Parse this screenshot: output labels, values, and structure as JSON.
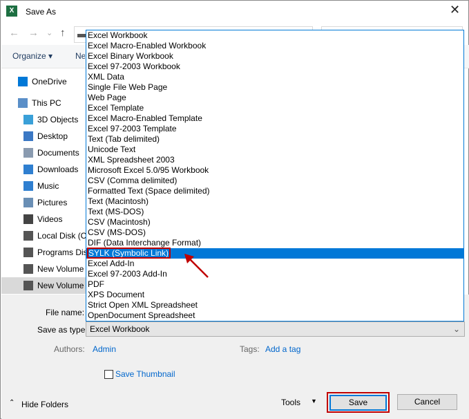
{
  "window": {
    "title": "Save As",
    "app_icon": "excel-icon",
    "close": "✕"
  },
  "nav": {
    "back": "←",
    "forward": "→",
    "recent": "⌄",
    "up": "↑"
  },
  "toolbar": {
    "organize": "Organize ▾",
    "new_folder": "New folder"
  },
  "sidebar": {
    "items": [
      {
        "label": "OneDrive",
        "icon": "cloud-icon",
        "color": "#0078d7",
        "top": true
      },
      {
        "label": "This PC",
        "icon": "computer-icon",
        "color": "#5a8fc8",
        "top": true
      },
      {
        "label": "3D Objects",
        "icon": "cube-icon",
        "color": "#3aa0d8"
      },
      {
        "label": "Desktop",
        "icon": "desktop-icon",
        "color": "#3b78c4"
      },
      {
        "label": "Documents",
        "icon": "document-icon",
        "color": "#8a9bb0"
      },
      {
        "label": "Downloads",
        "icon": "download-icon",
        "color": "#2f7fd0"
      },
      {
        "label": "Music",
        "icon": "music-icon",
        "color": "#2f7fd0"
      },
      {
        "label": "Pictures",
        "icon": "pictures-icon",
        "color": "#6a8fb5"
      },
      {
        "label": "Videos",
        "icon": "video-icon",
        "color": "#444"
      },
      {
        "label": "Local Disk (C:)",
        "icon": "drive-icon",
        "color": "#555"
      },
      {
        "label": "Programs Disk",
        "icon": "drive-icon",
        "color": "#555"
      },
      {
        "label": "New Volume",
        "icon": "drive-icon",
        "color": "#555"
      },
      {
        "label": "New Volume",
        "icon": "drive-icon",
        "color": "#555",
        "selected": true
      }
    ]
  },
  "form": {
    "file_name_label": "File name:",
    "save_as_type_label": "Save as type:",
    "save_as_type_value": "Excel Workbook",
    "authors_label": "Authors:",
    "authors_value": "Admin",
    "tags_label": "Tags:",
    "tags_value": "Add a tag",
    "thumbnail_label": "Save Thumbnail",
    "thumbnail_checked": false
  },
  "footer": {
    "hide_folders": "Hide Folders",
    "tools": "Tools",
    "save": "Save",
    "cancel": "Cancel"
  },
  "dropdown": {
    "selected_index": 21,
    "highlight_color": "#0078d7",
    "annotation_color": "#c00000",
    "options": [
      "Excel Workbook",
      "Excel Macro-Enabled Workbook",
      "Excel Binary Workbook",
      "Excel 97-2003 Workbook",
      "XML Data",
      "Single File Web Page",
      "Web Page",
      "Excel Template",
      "Excel Macro-Enabled Template",
      "Excel 97-2003 Template",
      "Text (Tab delimited)",
      "Unicode Text",
      "XML Spreadsheet 2003",
      "Microsoft Excel 5.0/95 Workbook",
      "CSV (Comma delimited)",
      "Formatted Text (Space delimited)",
      "Text (Macintosh)",
      "Text (MS-DOS)",
      "CSV (Macintosh)",
      "CSV (MS-DOS)",
      "DIF (Data Interchange Format)",
      "SYLK (Symbolic Link)",
      "Excel Add-In",
      "Excel 97-2003 Add-In",
      "PDF",
      "XPS Document",
      "Strict Open XML Spreadsheet",
      "OpenDocument Spreadsheet"
    ]
  }
}
